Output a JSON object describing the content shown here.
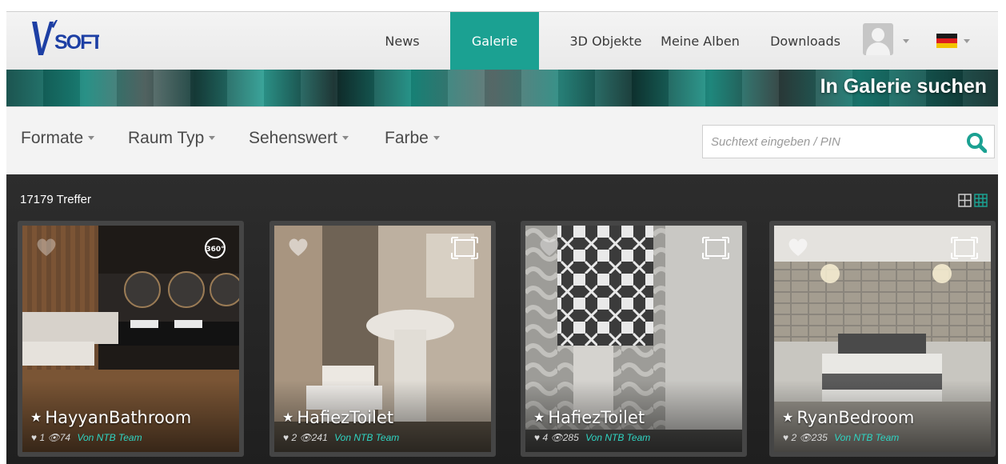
{
  "nav": {
    "logo": "VISOFT",
    "items": [
      "News",
      "Galerie",
      "3D Objekte",
      "Meine Alben",
      "Downloads"
    ],
    "active": "Galerie"
  },
  "banner": {
    "title": "In Galerie suchen"
  },
  "filters": [
    "Formate",
    "Raum Typ",
    "Sehenswert",
    "Farbe"
  ],
  "search": {
    "placeholder": "Suchtext eingeben / PIN",
    "value": ""
  },
  "gallery": {
    "result_count": "17179 Treffer",
    "cards": [
      {
        "title": "HayyanBathroom",
        "likes": "1",
        "views": "74",
        "author": "Von NTB Team",
        "corner": "360-icon"
      },
      {
        "title": "HafiezToilet",
        "likes": "2",
        "views": "241",
        "author": "Von NTB Team",
        "corner": "fullscreen-icon"
      },
      {
        "title": "HafiezToilet",
        "likes": "4",
        "views": "285",
        "author": "Von NTB Team",
        "corner": "fullscreen-icon"
      },
      {
        "title": "RyanBedroom",
        "likes": "2",
        "views": "235",
        "author": "Von NTB Team",
        "corner": "fullscreen-icon"
      }
    ]
  },
  "colors": {
    "accent": "#1ba192",
    "author_link": "#2fd5c3",
    "gallery_bg": "#262626",
    "language_flag": "de"
  }
}
